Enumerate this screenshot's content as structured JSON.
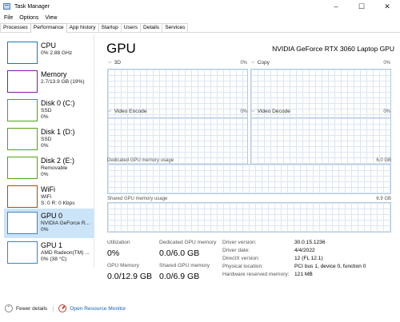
{
  "window": {
    "title": "Task Manager",
    "minimize": "–",
    "maximize": "☐",
    "close": "✕"
  },
  "menu": [
    "File",
    "Options",
    "View"
  ],
  "tabs": [
    "Processes",
    "Performance",
    "App history",
    "Startup",
    "Users",
    "Details",
    "Services"
  ],
  "sidebar": {
    "items": [
      {
        "name": "CPU",
        "lines": [
          "0%  2.88 GHz"
        ],
        "color": "#1779ba"
      },
      {
        "name": "Memory",
        "lines": [
          "2.7/13.9 GB (19%)"
        ],
        "color": "#8b12ae"
      },
      {
        "name": "Disk 0 (C:)",
        "lines": [
          "SSD",
          "0%"
        ],
        "color": "#4da60c"
      },
      {
        "name": "Disk 1 (D:)",
        "lines": [
          "SSD",
          "0%"
        ],
        "color": "#4da60c"
      },
      {
        "name": "Disk 2 (E:)",
        "lines": [
          "Removable",
          "0%"
        ],
        "color": "#4da60c"
      },
      {
        "name": "WiFi",
        "lines": [
          "WiFi",
          "S: 0 R: 0 Kbps"
        ],
        "color": "#a74f01"
      },
      {
        "name": "GPU 0",
        "lines": [
          "NVIDIA GeForce R...",
          "0%"
        ],
        "color": "#3a84c9"
      },
      {
        "name": "GPU 1",
        "lines": [
          "AMD Radeon(TM) ...",
          "0%  (38 °C)"
        ],
        "color": "#3a84c9"
      }
    ]
  },
  "main": {
    "title": "GPU",
    "model": "NVIDIA GeForce RTX 3060 Laptop GPU",
    "graphs": [
      {
        "label": "3D",
        "value": "0%"
      },
      {
        "label": "Copy",
        "value": "0%"
      },
      {
        "label": "Video Encode",
        "value": "0%"
      },
      {
        "label": "Video Decode",
        "value": "0%"
      }
    ],
    "dedicated": {
      "label": "Dedicated GPU memory usage",
      "max": "6.0 GB"
    },
    "shared": {
      "label": "Shared GPU memory usage",
      "max": "6.9 GB"
    },
    "stats": {
      "utilization_label": "Utilization",
      "utilization_value": "0%",
      "dedicated_label": "Dedicated GPU memory",
      "dedicated_value": "0.0/6.0 GB",
      "gpu_memory_label": "GPU Memory",
      "gpu_memory_value": "0.0/12.9 GB",
      "shared_label": "Shared GPU memory",
      "shared_value": "0.0/6.9 GB"
    },
    "driver": [
      {
        "label": "Driver version:",
        "value": "30.0.15.1236"
      },
      {
        "label": "Driver date:",
        "value": "4/4/2022"
      },
      {
        "label": "DirectX version:",
        "value": "12 (FL 12.1)"
      },
      {
        "label": "Physical location:",
        "value": "PCI bus 1, device 0, function 0"
      },
      {
        "label": "Hardware reserved memory:",
        "value": "121 MB"
      }
    ]
  },
  "footer": {
    "fewer_details": "Fewer details",
    "resource_monitor": "Open Resource Monitor"
  }
}
